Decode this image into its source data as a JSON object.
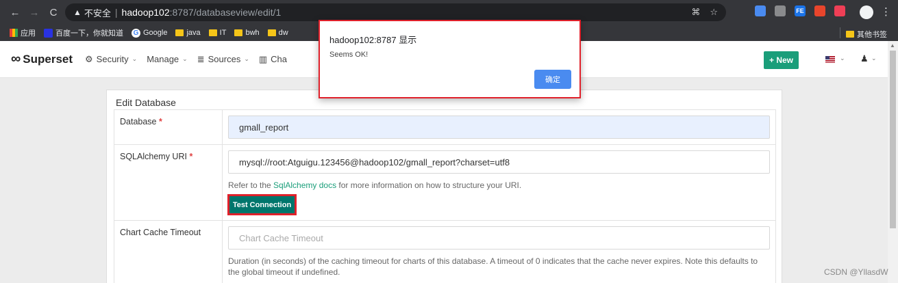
{
  "browser": {
    "security_label": "不安全",
    "url_host": "hadoop102",
    "url_path": ":8787/databaseview/edit/1",
    "bookmarks": [
      "应用",
      "百度一下，你就知道",
      "Google",
      "java",
      "IT",
      "bwh",
      "dw"
    ],
    "other_bookmarks": "其他书签",
    "extensions": [
      {
        "name": "translate-ext-icon",
        "color": "#4a8bf0",
        "text": ""
      },
      {
        "name": "shield-ext-icon",
        "color": "#8a8b8d",
        "text": ""
      },
      {
        "name": "fe-ext-icon",
        "color": "#1a73e8",
        "text": "FE"
      },
      {
        "name": "red-ext-icon",
        "color": "#e8452c",
        "text": ""
      },
      {
        "name": "pocket-ext-icon",
        "color": "#ef3f56",
        "text": ""
      }
    ]
  },
  "navbar": {
    "brand": "Superset",
    "menu": [
      "Security",
      "Manage",
      "Sources",
      "Cha"
    ],
    "new_button": "+ New"
  },
  "form": {
    "title": "Edit Database",
    "database_label": "Database",
    "database_value": "gmall_report",
    "uri_label": "SQLAlchemy URI",
    "uri_value": "mysql://root:Atguigu.123456@hadoop102/gmall_report?charset=utf8",
    "uri_help_prefix": "Refer to the ",
    "uri_help_link": "SqlAlchemy docs",
    "uri_help_suffix": " for more information on how to structure your URI.",
    "test_button": "Test Connection",
    "cache_label": "Chart Cache Timeout",
    "cache_placeholder": "Chart Cache Timeout",
    "cache_help": "Duration (in seconds) of the caching timeout for charts of this database. A timeout of 0 indicates that the cache never expires. Note this defaults to the global timeout if undefined."
  },
  "dialog": {
    "title": "hadoop102:8787 显示",
    "message": "Seems OK!",
    "ok_button": "确定"
  },
  "watermark": "CSDN @YllasdW"
}
